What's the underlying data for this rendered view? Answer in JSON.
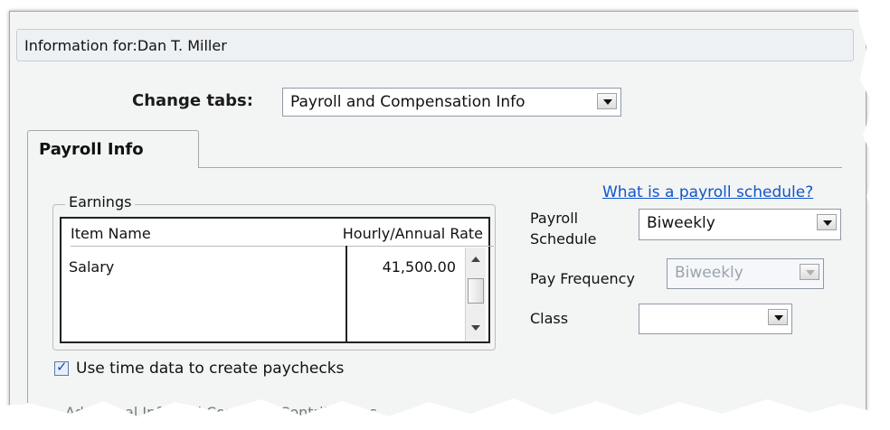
{
  "header": {
    "info_label": "Information for:Dan T. Miller"
  },
  "change_tabs": {
    "label": "Change tabs:",
    "value": "Payroll and Compensation Info"
  },
  "tab": {
    "label": "Payroll Info"
  },
  "earnings": {
    "title": "Earnings",
    "columns": [
      "Item Name",
      "Hourly/Annual Rate"
    ],
    "rows": [
      {
        "item": "Salary",
        "rate": "41,500.00"
      }
    ]
  },
  "payroll_schedule": {
    "link": "What is a payroll schedule?",
    "label_line1": "Payroll",
    "label_line2": "Schedule",
    "value": "Biweekly"
  },
  "pay_frequency": {
    "label": "Pay Frequency",
    "value": "Biweekly"
  },
  "class": {
    "label": "Class",
    "value": ""
  },
  "use_time": {
    "label": "Use time data to create paychecks",
    "checked": true
  },
  "cut_off_text": "Additional Info and Company Contributions"
}
